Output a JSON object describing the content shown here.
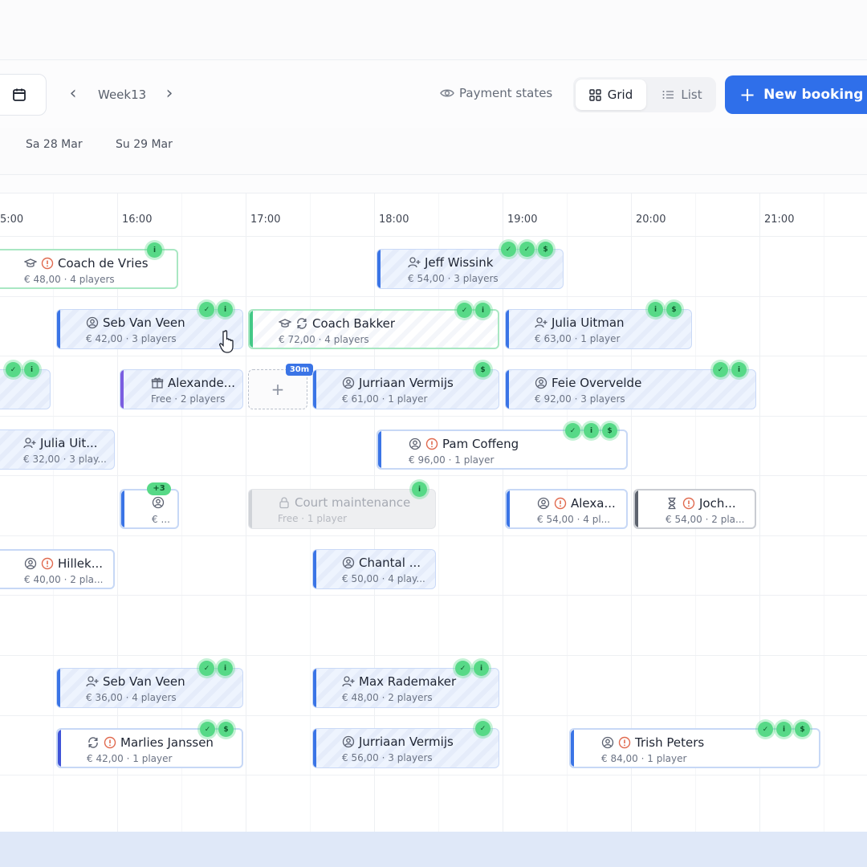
{
  "toolbar": {
    "week_label": "Week13",
    "payment_states_label": "Payment states",
    "grid_label": "Grid",
    "list_label": "List",
    "new_booking_label": "New booking",
    "accent_color": "#2f6fea"
  },
  "days": [
    "Sa 28 Mar",
    "Su 29 Mar"
  ],
  "times": [
    "5:00",
    "16:00",
    "17:00",
    "18:00",
    "19:00",
    "20:00",
    "21:00"
  ],
  "slot_tag": "30m",
  "overflow_tag": "+3",
  "bookings": [
    {
      "name": "Coach de Vries",
      "detail": "€ 48,00 · 4 players"
    },
    {
      "name": "Jeff Wissink",
      "detail": "€ 54,00 · 3 players"
    },
    {
      "name": "Seb Van Veen",
      "detail": "€ 42,00 · 3 players"
    },
    {
      "name": "Coach Bakker",
      "detail": "€ 72,00 · 4 players"
    },
    {
      "name": "Julia Uitman",
      "detail": "€ 63,00 · 1 player"
    },
    {
      "name": "Alexande...",
      "detail": "Free · 2 players"
    },
    {
      "name": "Jurriaan Vermijs",
      "detail": "€ 61,00 · 1 player"
    },
    {
      "name": "Feie Overvelde",
      "detail": "€ 92,00 · 3 players"
    },
    {
      "name": "Julia Uit...",
      "detail": "€ 32,00 · 3 play..."
    },
    {
      "name": "Pam Coffeng",
      "detail": "€ 96,00 · 1 player"
    },
    {
      "name": "",
      "detail": "€ ..."
    },
    {
      "name": "Court maintenance",
      "detail": "Free · 1 player"
    },
    {
      "name": "Alexa...",
      "detail": "€ 54,00 · 4 pl..."
    },
    {
      "name": "Joch...",
      "detail": "€ 54,00 · 2 pla..."
    },
    {
      "name": "Hillek...",
      "detail": "€ 40,00 · 2 pla..."
    },
    {
      "name": "Chantal ...",
      "detail": "€ 50,00 · 4 play..."
    },
    {
      "name": "Seb Van Veen",
      "detail": "€ 36,00 · 4 players"
    },
    {
      "name": "Max Rademaker",
      "detail": "€ 48,00 · 2 players"
    },
    {
      "name": "Marlies Janssen",
      "detail": "€ 42,00 · 1 player"
    },
    {
      "name": "Jurriaan Vermijs",
      "detail": "€ 56,00 · 3 players"
    },
    {
      "name": "Trish Peters",
      "detail": "€ 84,00 · 1 player"
    }
  ]
}
